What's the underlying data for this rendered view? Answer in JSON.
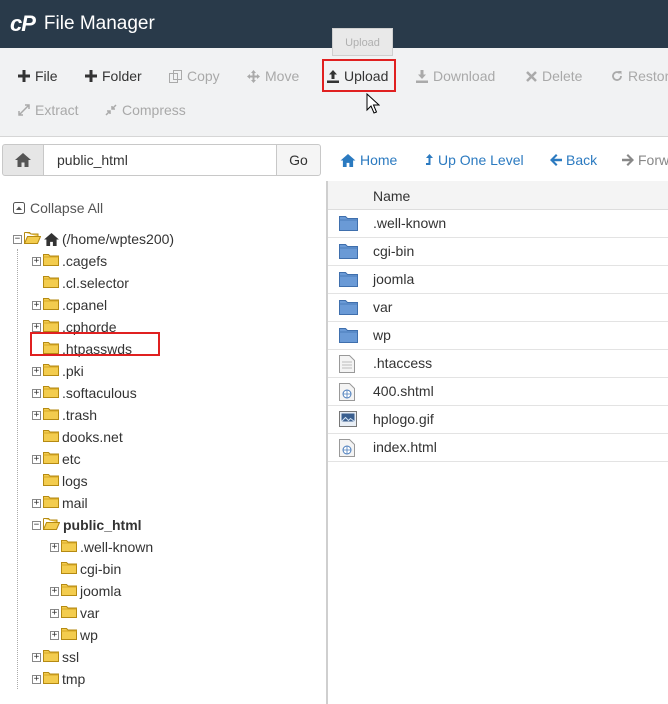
{
  "header": {
    "logo": "cP",
    "title": "File Manager"
  },
  "toolbar": {
    "file": "File",
    "folder": "Folder",
    "copy": "Copy",
    "move": "Move",
    "upload": "Upload",
    "download": "Download",
    "delete": "Delete",
    "restore": "Restore",
    "extract": "Extract",
    "compress": "Compress",
    "tooltip": "Upload"
  },
  "pathbar": {
    "path_value": "public_html",
    "go": "Go"
  },
  "nav": {
    "home": "Home",
    "up_one_level": "Up One Level",
    "back": "Back",
    "forward": "Forward"
  },
  "tree": {
    "collapse_all": "Collapse All",
    "root": "(/home/wptes200)",
    "items": [
      ".cagefs",
      ".cl.selector",
      ".cpanel",
      ".cphorde",
      ".htpasswds",
      ".pki",
      ".softaculous",
      ".trash",
      "dooks.net",
      "etc",
      "logs",
      "mail",
      "public_html",
      ".well-known",
      "cgi-bin",
      "joomla",
      "var",
      "wp",
      "ssl",
      "tmp"
    ]
  },
  "files": {
    "header_name": "Name",
    "rows": [
      {
        "name": ".well-known",
        "type": "folder"
      },
      {
        "name": "cgi-bin",
        "type": "folder"
      },
      {
        "name": "joomla",
        "type": "folder"
      },
      {
        "name": "var",
        "type": "folder"
      },
      {
        "name": "wp",
        "type": "folder"
      },
      {
        "name": ".htaccess",
        "type": "text"
      },
      {
        "name": "400.shtml",
        "type": "html"
      },
      {
        "name": "hplogo.gif",
        "type": "image"
      },
      {
        "name": "index.html",
        "type": "html"
      }
    ]
  },
  "colors": {
    "header_bg": "#293a4a",
    "link": "#2b7ac0",
    "highlight": "#e02020",
    "folder_blue": "#5b8fcf",
    "folder_yellow": "#f0c23a"
  }
}
